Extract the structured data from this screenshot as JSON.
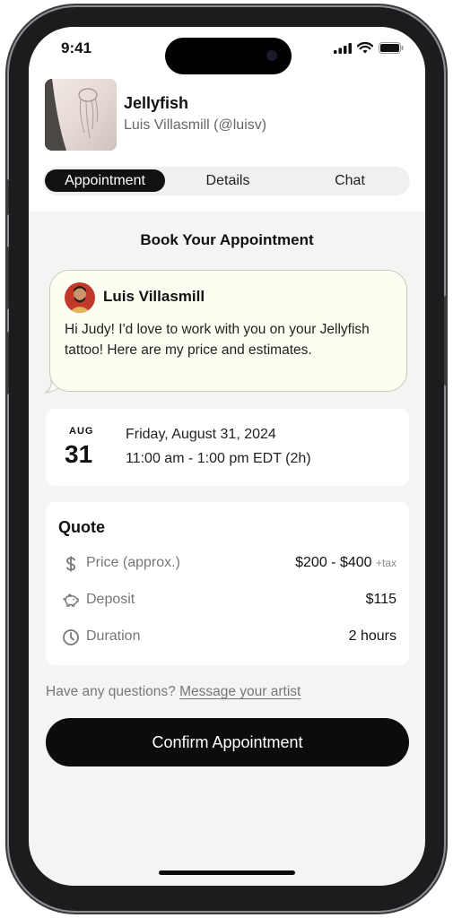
{
  "status_bar": {
    "time": "9:41",
    "icons": [
      "signal-icon",
      "wifi-icon",
      "battery-icon"
    ]
  },
  "header": {
    "title": "Jellyfish",
    "artist": "Luis Villasmill (@luisv)",
    "thumbnail_icon": "tattoo-photo"
  },
  "tabs": {
    "items": [
      "Appointment",
      "Details",
      "Chat"
    ],
    "active": "Appointment"
  },
  "main": {
    "heading": "Book Your Appointment",
    "message": {
      "sender": "Luis Villasmill",
      "text": "Hi Judy! I'd love to work with you on your Jellyfish tattoo! Here are my price and estimates."
    },
    "date": {
      "month": "AUG",
      "day": "31",
      "full_date": "Friday, August 31, 2024",
      "time_range": "11:00 am - 1:00 pm EDT (2h)"
    },
    "quote": {
      "title": "Quote",
      "rows": [
        {
          "icon": "dollar-icon",
          "label": "Price (approx.)",
          "value": "$200 - $400",
          "suffix": "+tax"
        },
        {
          "icon": "piggy-bank-icon",
          "label": "Deposit",
          "value": "$115"
        },
        {
          "icon": "clock-icon",
          "label": "Duration",
          "value": "2 hours"
        }
      ]
    },
    "questions": {
      "prompt": "Have any questions?",
      "link": "Message your artist"
    },
    "confirm_label": "Confirm Appointment"
  },
  "colors": {
    "primary": "#0c0c0c",
    "bubble_bg": "#fefdf1",
    "screen_bg": "#f4f4f3"
  }
}
